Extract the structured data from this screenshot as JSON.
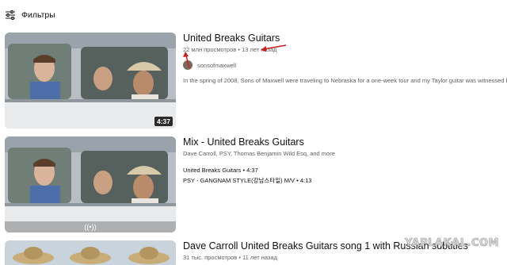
{
  "filters": {
    "label": "Фильтры",
    "icon": "sliders-icon"
  },
  "results": [
    {
      "title": "United Breaks Guitars",
      "views": "22 млн просмотров",
      "age": "13 лет назад",
      "channel": "sonsofmaxwell",
      "description": "In the spring of 2008, Sons of Maxwell were traveling to Nebraska for a one-week tour and my Taylor guitar was witnessed being",
      "duration": "4:37"
    },
    {
      "title": "Mix - United Breaks Guitars",
      "subtitle": "Dave Carroll, PSY, Thomas Benjamin Wild Esq, and more",
      "mix_items": [
        "United Breaks Guitars • 4:37",
        "PSY - GANGNAM STYLE(강남스타일) M/V • 4:13"
      ],
      "badge_icon": "radio-icon"
    },
    {
      "title": "Dave Carroll United Breaks Guitars song 1 with Russian subtitles",
      "views": "31 тыс. просмотров",
      "age": "11 лет назад"
    }
  ],
  "watermark": "YAPLAKAL.COM",
  "colors": {
    "annotation_arrow": "#d11a1a",
    "duration_bg": "#000000",
    "meta_text": "#606060"
  }
}
